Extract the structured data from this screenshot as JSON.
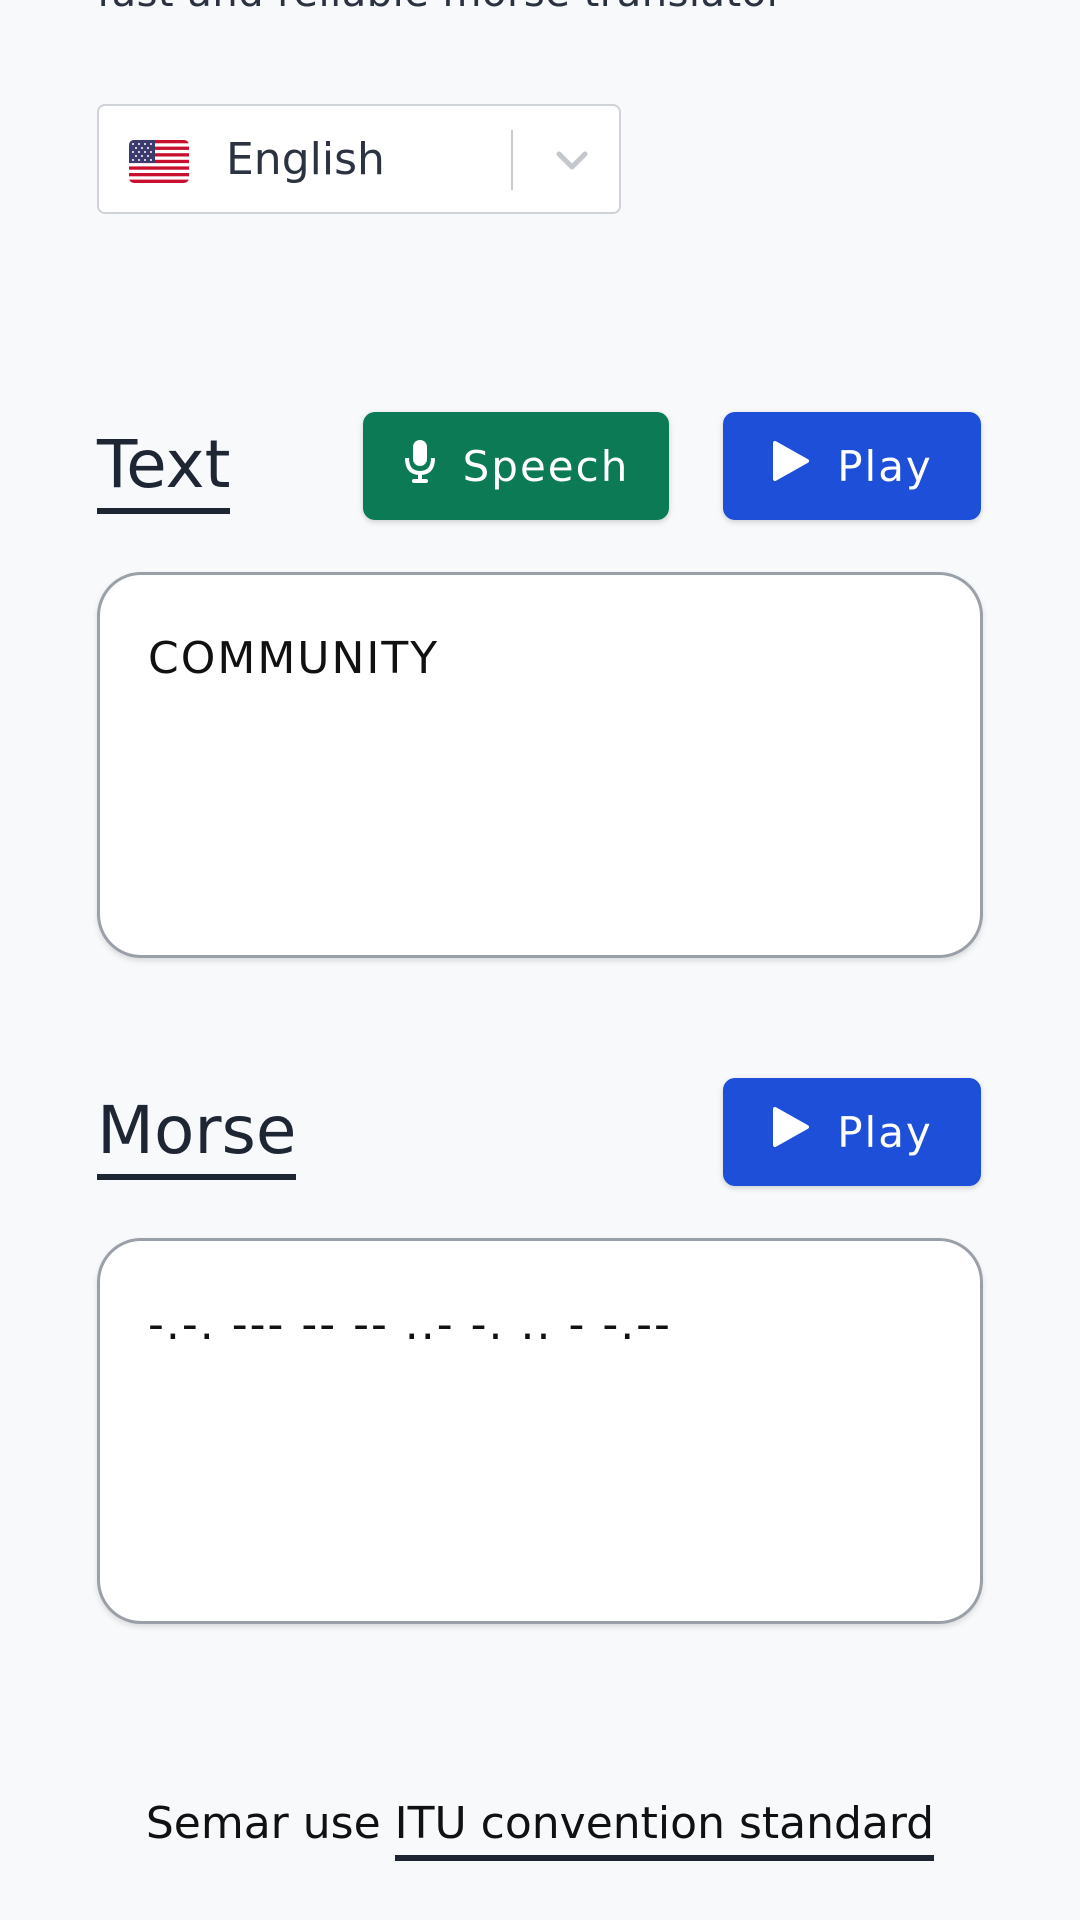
{
  "header": {
    "tagline": "fast and reliable morse translator"
  },
  "language_select": {
    "selected": "English",
    "flag": "us-flag-icon"
  },
  "text_section": {
    "title": "Text",
    "speech_label": "Speech",
    "play_label": "Play",
    "value": "COMMUNITY"
  },
  "morse_section": {
    "title": "Morse",
    "play_label": "Play",
    "value": "-.-. --- -- -- ..- -. .. - -.--"
  },
  "footer": {
    "prefix": "Semar use ",
    "link_text": "ITU convention standard"
  },
  "colors": {
    "speech_button": "#0b7a55",
    "play_button": "#1d4fd8",
    "text_primary": "#1e2533",
    "background": "#f8f9fb"
  }
}
